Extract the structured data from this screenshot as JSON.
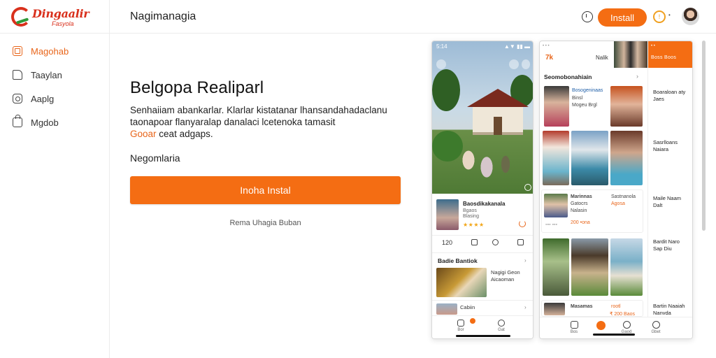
{
  "brand": {
    "name": "Dingaalir",
    "tagline": "Fasyola"
  },
  "header": {
    "title": "Nagimanagia",
    "install_label": "Install",
    "coin_symbol": "!",
    "caret": "•"
  },
  "sidebar": {
    "items": [
      {
        "label": "Magohab",
        "icon": "grid-icon",
        "active": true
      },
      {
        "label": "Taaylan",
        "icon": "thumbs-up-icon",
        "active": false
      },
      {
        "label": "Aaplg",
        "icon": "puzzle-icon",
        "active": false
      },
      {
        "label": "Mgdob",
        "icon": "bag-icon",
        "active": false
      }
    ]
  },
  "main": {
    "title": "Belgopa Realiparl",
    "description_line1": "Senhaiiam abankarlar. Klarlar kistatanar lhansandahadaclanu",
    "description_line2": "taonapoar flanyaralap danalaci lcetenoka tamasit",
    "description_highlight": "Gooar",
    "description_tail": "ceat adgaps.",
    "subheading": "Negomlaria",
    "cta_label": "Inoha Instal",
    "cta_note": "Rema Uhagia Buban"
  },
  "phone1": {
    "status_time": "5:14",
    "status_icons": "▲▼ ▮▮ ▬",
    "card_title": "Baosdikakanala",
    "card_line1": "Bgaos",
    "card_line2": "Blasing",
    "rating_stars": "★★★★",
    "actions": {
      "count": "120"
    },
    "section_title": "Badie Bantiok",
    "food_caption_1": "Nagigi Geon",
    "food_caption_2": "Aicaoman",
    "mini_caption": "Cabiin",
    "tabs": [
      "Bor",
      "Gat"
    ],
    "chevron": "›"
  },
  "phone2": {
    "header_logo": "7k",
    "header_label": "Nalik",
    "header_dots": "• • •",
    "orange_text": "Boss Boos",
    "orange_top": "• •",
    "section_title": "Seomobonahiain",
    "chevron": "›",
    "row1": {
      "title": "Bosogeninaas",
      "lines": [
        "Binsl",
        "Mogeu Brgl"
      ]
    },
    "row2": {
      "title": "Marinnas",
      "lines": [
        "Gatocrs",
        "Nalasin"
      ],
      "price": "200 •ona"
    },
    "row2_right": {
      "title": "Sastnanola",
      "price": "Agosa"
    },
    "row3": {
      "title": "Masamas",
      "price": "rootl"
    },
    "bottom_price": "₹ 200 Baos",
    "row_footer": "◦◦◦ ◦◦◦",
    "right_column": [
      {
        "title": "Boaraloan aty",
        "sub": "Jaes"
      },
      {
        "title": "Sasrlloans",
        "sub": "Naiara"
      },
      {
        "title": "Maile Naam",
        "sub": "Dalt"
      },
      {
        "title": "Bardit Naro",
        "sub": "Sap Diu"
      },
      {
        "title": "Bartin Naaiah",
        "sub": "Nanvda"
      }
    ],
    "tabs": [
      "Bos",
      "",
      "Gaod",
      "Gbet"
    ]
  },
  "colors": {
    "accent": "#f46d13",
    "brand_red": "#d9301c",
    "brand_green": "#2e9a3a"
  }
}
